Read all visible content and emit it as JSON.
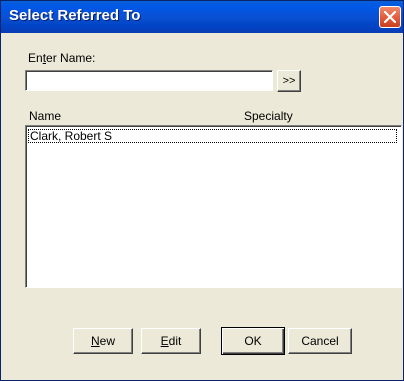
{
  "window": {
    "title": "Select Referred To"
  },
  "search": {
    "label_pre": "En",
    "label_u": "t",
    "label_post": "er Name:",
    "value": "",
    "go_label": ">>"
  },
  "list": {
    "columns": [
      "Name",
      "Specialty"
    ],
    "rows": [
      {
        "name": "Clark, Robert S",
        "specialty": ""
      }
    ]
  },
  "buttons": {
    "new_u": "N",
    "new_rest": "ew",
    "edit_u": "E",
    "edit_rest": "dit",
    "ok": "OK",
    "cancel": "Cancel"
  },
  "icons": {
    "close": "close-icon"
  },
  "colors": {
    "titlebar": "#0058e7",
    "close": "#e35a3a",
    "dialog_bg": "#ece9d8"
  }
}
